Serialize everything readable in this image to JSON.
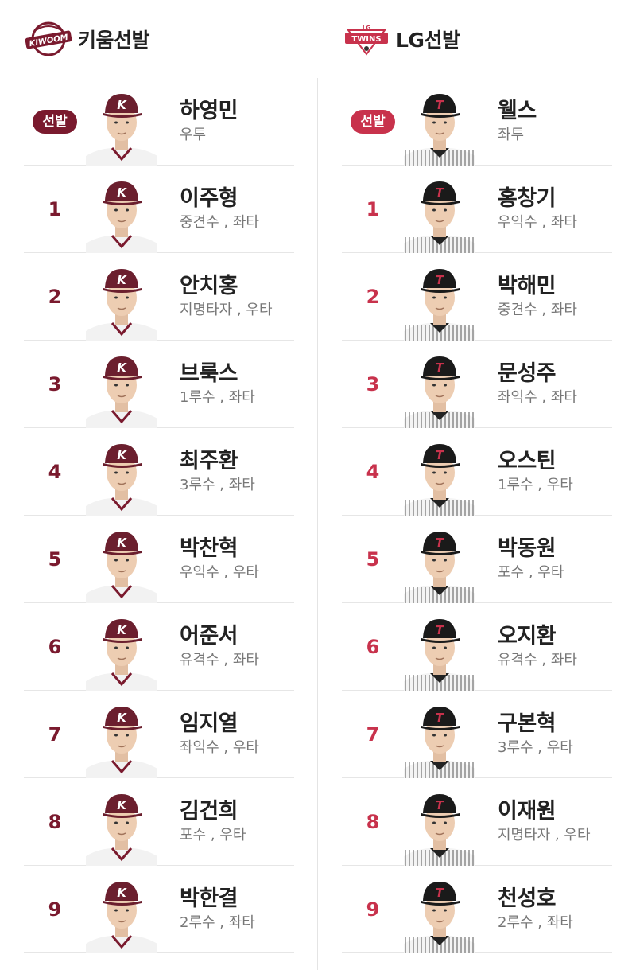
{
  "teams": [
    {
      "key": "kiwoom",
      "title": "키움선발",
      "logo_icon": "kiwoom-logo-icon",
      "accent": "#7a1a2e",
      "cap_color": "#6b1f2e",
      "uniform": "kiwoom",
      "starter_label": "선발",
      "players": [
        {
          "order": "선발",
          "name": "하영민",
          "meta": "우투",
          "starter": true
        },
        {
          "order": "1",
          "name": "이주형",
          "meta": "중견수 , 좌타"
        },
        {
          "order": "2",
          "name": "안치홍",
          "meta": "지명타자 , 우타"
        },
        {
          "order": "3",
          "name": "브룩스",
          "meta": "1루수 , 좌타"
        },
        {
          "order": "4",
          "name": "최주환",
          "meta": "3루수 , 좌타"
        },
        {
          "order": "5",
          "name": "박찬혁",
          "meta": "우익수 , 우타"
        },
        {
          "order": "6",
          "name": "어준서",
          "meta": "유격수 , 좌타"
        },
        {
          "order": "7",
          "name": "임지열",
          "meta": "좌익수 , 우타"
        },
        {
          "order": "8",
          "name": "김건희",
          "meta": "포수 , 우타"
        },
        {
          "order": "9",
          "name": "박한결",
          "meta": "2루수 , 좌타"
        }
      ]
    },
    {
      "key": "lg",
      "title": "LG선발",
      "logo_icon": "lg-twins-logo-icon",
      "logo_text": "TWINS",
      "logo_small": "LG",
      "accent": "#c8324c",
      "cap_color": "#1a1a1a",
      "uniform": "lg",
      "starter_label": "선발",
      "players": [
        {
          "order": "선발",
          "name": "웰스",
          "meta": "좌투",
          "starter": true
        },
        {
          "order": "1",
          "name": "홍창기",
          "meta": "우익수 , 좌타"
        },
        {
          "order": "2",
          "name": "박해민",
          "meta": "중견수 , 좌타"
        },
        {
          "order": "3",
          "name": "문성주",
          "meta": "좌익수 , 좌타"
        },
        {
          "order": "4",
          "name": "오스틴",
          "meta": "1루수 , 우타"
        },
        {
          "order": "5",
          "name": "박동원",
          "meta": "포수 , 우타"
        },
        {
          "order": "6",
          "name": "오지환",
          "meta": "유격수 , 좌타"
        },
        {
          "order": "7",
          "name": "구본혁",
          "meta": "3루수 , 우타"
        },
        {
          "order": "8",
          "name": "이재원",
          "meta": "지명타자 , 우타"
        },
        {
          "order": "9",
          "name": "천성호",
          "meta": "2루수 , 좌타"
        }
      ]
    }
  ]
}
